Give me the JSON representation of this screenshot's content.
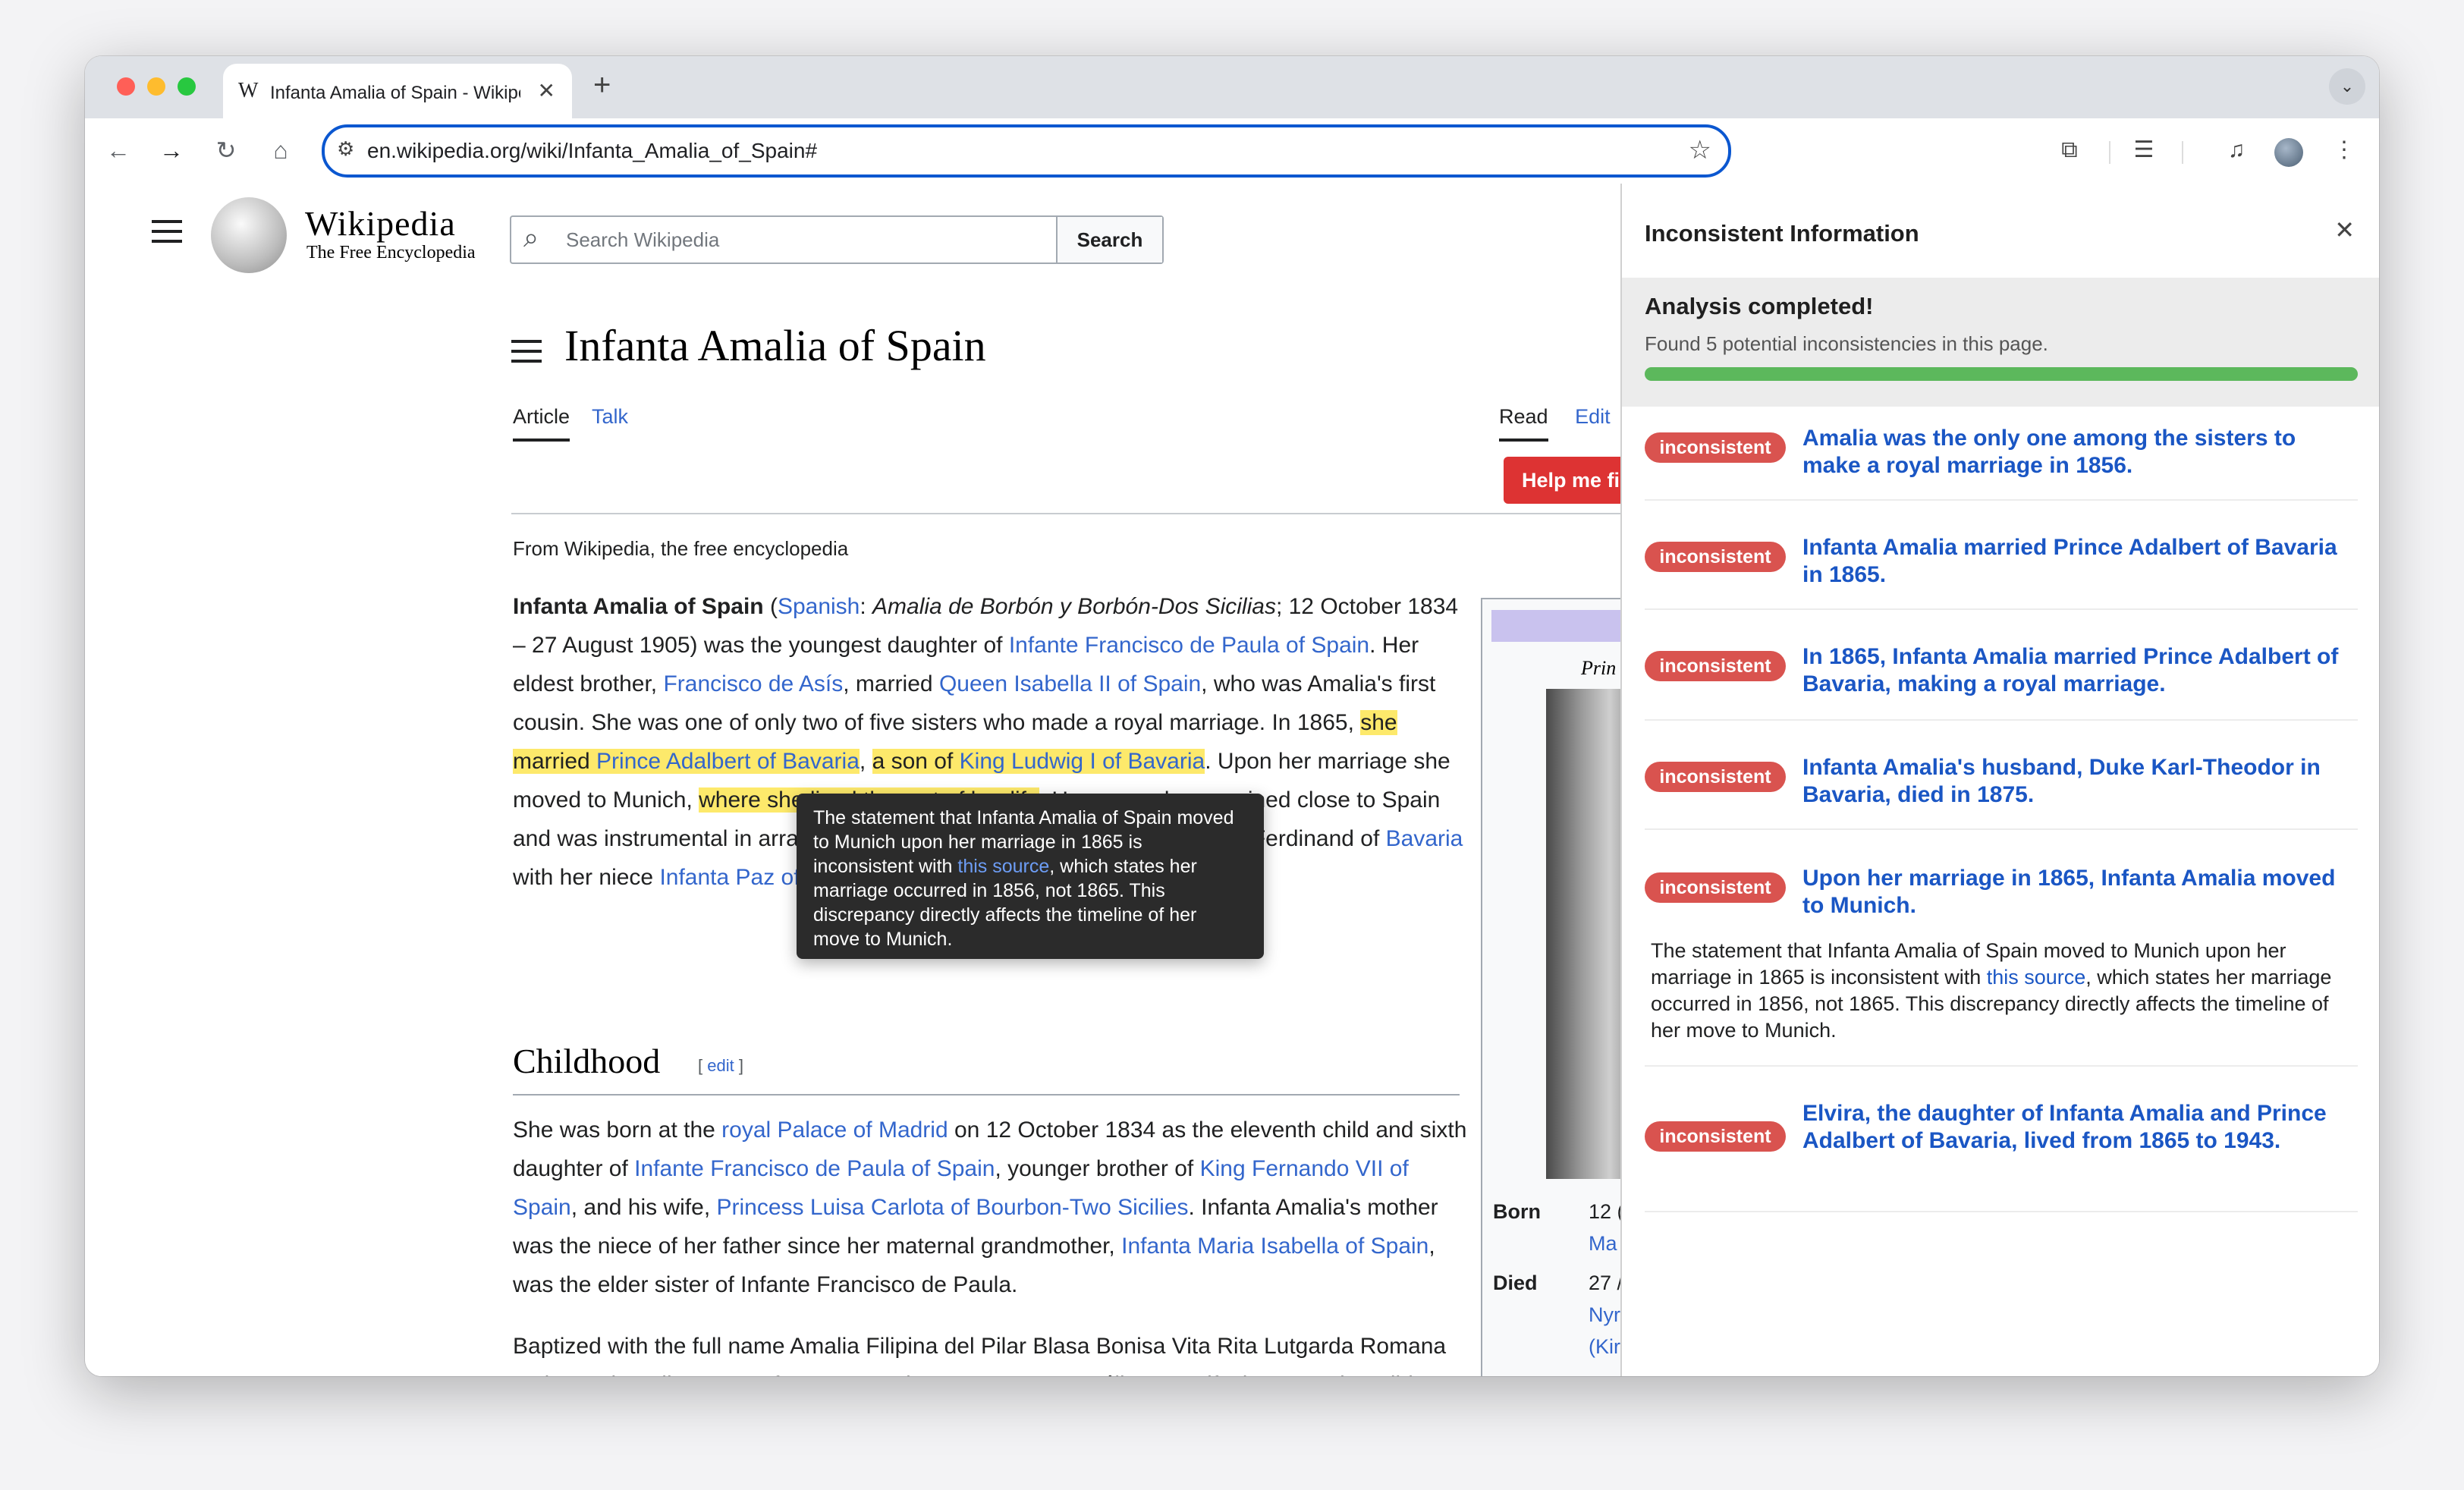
{
  "browser": {
    "tab_title": "Infanta Amalia of Spain - Wikipedia",
    "tab_favicon": "W",
    "url": "en.wikipedia.org/wiki/Infanta_Amalia_of_Spain#",
    "icons": [
      "back-icon",
      "forward-icon",
      "reload-icon",
      "home-icon",
      "site-info-icon",
      "bookmark-star-icon",
      "extensions-icon",
      "reading-mode-icon",
      "media-controls-icon",
      "profile-avatar",
      "kebab-menu-icon"
    ]
  },
  "wiki": {
    "wordmark": "Wikipedia",
    "tagline": "The Free Encyclopedia",
    "search_placeholder": "Search Wikipedia",
    "search_button": "Search",
    "title": "Infanta Amalia of Spain",
    "tab_article": "Article",
    "tab_talk": "Talk",
    "tab_read": "Read",
    "tab_edit": "Edit",
    "help_button": "Help me fi",
    "from": "From Wikipedia, the free encyclopedia",
    "section_childhood": "Childhood",
    "section_edit": "edit",
    "infobox_caption": "Prin",
    "infobox_born_label": "Born",
    "infobox_born_1": "12 (",
    "infobox_born_2": "Ma",
    "infobox_died_label": "Died",
    "infobox_died_1": "27 /",
    "infobox_died_2": "Nyr",
    "infobox_died_3": "(Kir"
  },
  "tooltip": {
    "before": "The statement that Infanta Amalia of Spain moved to Munich upon her marriage in 1865 is inconsistent with ",
    "link": "this source",
    "after": ", which states her marriage occurred in 1856, not 1865. This discrepancy directly affects the timeline of her move to Munich."
  },
  "panel": {
    "title": "Inconsistent Information",
    "status_title": "Analysis completed!",
    "status_text": "Found 5 potential inconsistencies in this page.",
    "progress": 1.0,
    "badge": "inconsistent",
    "items": [
      {
        "claim": "Amalia was the only one among the sisters to make a royal marriage in 1856."
      },
      {
        "claim": "Infanta Amalia married Prince Adalbert of Bavaria in 1865."
      },
      {
        "claim": "In 1865, Infanta Amalia married Prince Adalbert of Bavaria, making a royal marriage."
      },
      {
        "claim": "Infanta Amalia's husband, Duke Karl-Theodor in Bavaria, died in 1875."
      },
      {
        "claim": "Upon her marriage in 1865, Infanta Amalia moved to Munich.",
        "detail_before": "The statement that Infanta Amalia of Spain moved to Munich upon her marriage in 1865 is inconsistent with ",
        "detail_link": "this source",
        "detail_after": ", which states her marriage occurred in 1856, not 1865. This discrepancy directly affects the timeline of her move to Munich."
      },
      {
        "claim": "Elvira, the daughter of Infanta Amalia and Prince Adalbert of Bavaria, lived from 1865 to 1943."
      }
    ]
  },
  "colors": {
    "badge": "#d9534f",
    "progress": "#5cb85c",
    "link": "#3366cc",
    "highlight": "#fde96b"
  }
}
